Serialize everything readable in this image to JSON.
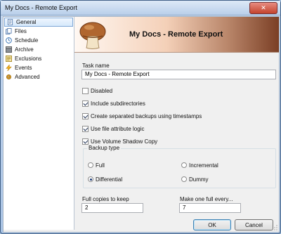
{
  "window": {
    "title": "My Docs - Remote Export",
    "close_glyph": "✕"
  },
  "nav": {
    "items": [
      {
        "label": "General",
        "icon": "document-icon",
        "selected": true
      },
      {
        "label": "Files",
        "icon": "files-icon"
      },
      {
        "label": "Schedule",
        "icon": "clock-icon"
      },
      {
        "label": "Archive",
        "icon": "archive-icon"
      },
      {
        "label": "Exclusions",
        "icon": "filter-icon"
      },
      {
        "label": "Events",
        "icon": "lightning-icon"
      },
      {
        "label": "Advanced",
        "icon": "gear-icon"
      }
    ]
  },
  "header": {
    "title": "My Docs - Remote Export",
    "logo_icon": "mushroom-icon"
  },
  "form": {
    "task_name_label": "Task name",
    "task_name_value": "My Docs - Remote Export",
    "checkboxes": [
      {
        "label": "Disabled",
        "checked": false
      },
      {
        "label": "Include subdirectories",
        "checked": true
      },
      {
        "label": "Create separated backups using timestamps",
        "checked": true
      },
      {
        "label": "Use file attribute logic",
        "checked": true
      },
      {
        "label": "Use Volume Shadow Copy",
        "checked": true
      }
    ],
    "backup_type": {
      "title": "Backup type",
      "options": [
        "Full",
        "Incremental",
        "Differential",
        "Dummy"
      ],
      "selected": "Differential"
    },
    "full_copies_label": "Full copies to keep",
    "full_copies_value": "2",
    "make_full_label": "Make one full every...",
    "make_full_value": "7"
  },
  "buttons": {
    "ok": "OK",
    "cancel": "Cancel"
  },
  "colors": {
    "accent": "#3c7fb1",
    "header_dark": "#7b3f25"
  }
}
